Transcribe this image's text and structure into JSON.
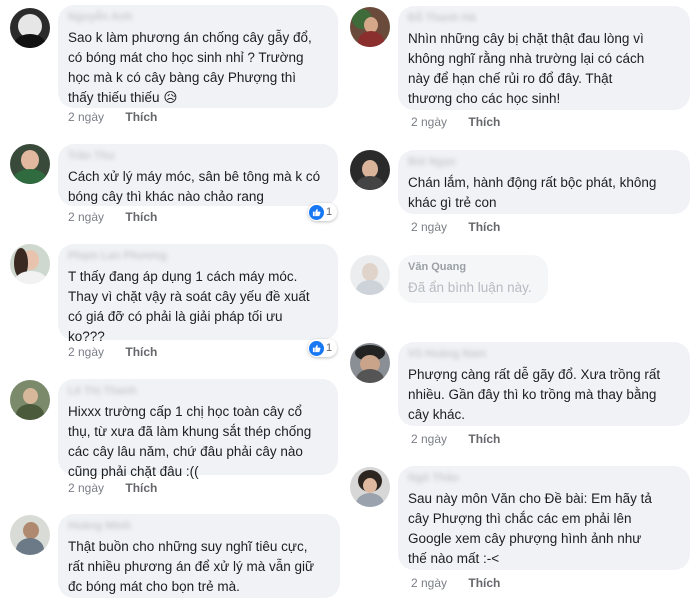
{
  "colors": {
    "bubble_bg": "#f0f2f5",
    "like_blue": "#1877f2",
    "meta_gray": "#7b7f86"
  },
  "reactions": {
    "icon": "like-thumb-icon",
    "count": "1"
  },
  "left_comments": [
    {
      "text": "Sao k làm phương án chống cây gẫy đổ,\ncó bóng mát cho học sinh nhỉ ? Trường\nhọc mà k có cây bàng cây Phượng thì\nthấy thiếu thiếu 😥",
      "time": "2 ngày",
      "like": "Thích"
    },
    {
      "text": "Cách xử lý máy móc, sân bê tông mà k có\nbóng cây thì khác nào chảo rang",
      "time": "2 ngày",
      "like": "Thích",
      "reaction_count": "1"
    },
    {
      "text": "T thấy đang áp dụng 1 cách máy móc.\nThay vì chặt vậy rà soát cây yếu đề xuất\ncó giá đỡ có phải là giải pháp tối ưu\nko???",
      "time": "2 ngày",
      "like": "Thích",
      "reaction_count": "1"
    },
    {
      "text": "Hixxx trường cấp 1 chị học toàn cây cổ\nthụ, từ xưa đã làm khung sắt thép chống\ncác cây lâu năm, chứ đâu phải cây nào\ncũng phải chặt đâu :((",
      "time": "2 ngày",
      "like": "Thích"
    },
    {
      "text": "Thật buồn cho những suy nghĩ tiêu cực,\nrất nhiều phương án để xử lý mà vẫn giữ\nđc bóng mát cho bọn trẻ mà."
    }
  ],
  "right_comments": [
    {
      "text": "Nhìn những cây bị chặt thật đau lòng vì\nkhông nghĩ rằng nhà trường lại có cách\nnày để hạn chế rủi ro đổ đây. Thật\nthương cho các học sinh!",
      "time": "2 ngày",
      "like": "Thích"
    },
    {
      "text": "Chán lắm, hành động rất bộc phát, không\nkhác gì trẻ con",
      "time": "2 ngày",
      "like": "Thích"
    },
    {
      "name": "Văn Quang",
      "text": "Đã ẩn bình luận này."
    },
    {
      "text": "Phượng càng rất dễ gãy đổ. Xưa trồng rất\nnhiều. Gần đây thì ko trồng mà thay bằng\ncây khác.",
      "time": "2 ngày",
      "like": "Thích"
    },
    {
      "text": "Sau này môn Văn cho Đề bài: Em hãy tả\ncây Phượng thì chắc các em phải lên\nGoogle xem cây phượng hình ảnh như\nthế nào mất :-<",
      "time": "2 ngày",
      "like": "Thích"
    }
  ]
}
